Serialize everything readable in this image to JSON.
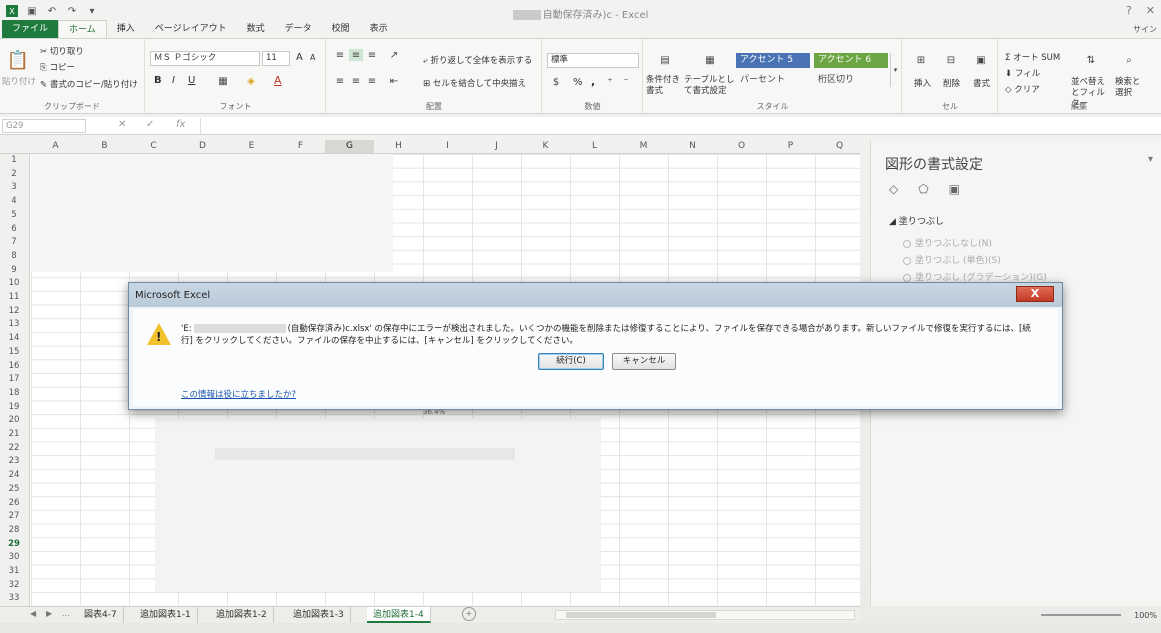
{
  "titlebar": {
    "title": "自動保存済み)c - Excel",
    "quick_access": [
      "excel-logo",
      "save",
      "undo",
      "redo"
    ]
  },
  "tabs": {
    "file": "ファイル",
    "items": [
      "ホーム",
      "挿入",
      "ページレイアウト",
      "数式",
      "データ",
      "校閲",
      "表示"
    ],
    "signin": "サイン"
  },
  "ribbon": {
    "clipboard": {
      "paste": "貼り付け",
      "cut": "切り取り",
      "copy": "コピー",
      "format_painter": "書式のコピー/貼り付け",
      "label": "クリップボード"
    },
    "font": {
      "font_name": "ＭＳ Ｐゴシック",
      "font_size": "11",
      "grow": "A",
      "shrink": "A",
      "bold": "B",
      "italic": "I",
      "underline": "U",
      "font_color": "A",
      "label": "フォント"
    },
    "alignment": {
      "wrap_text": "折り返して全体を表示する",
      "merge_center": "セルを結合して中央揃え",
      "label": "配置"
    },
    "number": {
      "format": "標準",
      "percent": "%",
      "comma": ",",
      "label": "数値"
    },
    "styles": {
      "conditional": "条件付き書式",
      "table": "テーブルとして書式設定",
      "accent5": "アクセント 5",
      "accent6": "アクセント 6",
      "percent": "パーセント",
      "comma": "桁区切り",
      "label": "スタイル"
    },
    "cells": {
      "insert": "挿入",
      "delete": "削除",
      "format": "書式",
      "label": "セル"
    },
    "editing": {
      "autosum": "オート SUM",
      "fill": "フィル",
      "clear": "クリア",
      "sort_filter": "並べ替えとフィルター",
      "find_select": "検索と選択",
      "label": "編集"
    }
  },
  "formula_bar": {
    "name_box": "G29",
    "fx": "fx"
  },
  "grid": {
    "columns": [
      "A",
      "B",
      "C",
      "D",
      "E",
      "F",
      "G",
      "H",
      "I",
      "J",
      "K",
      "L",
      "M",
      "N",
      "O",
      "P",
      "Q"
    ],
    "selected_column": "G",
    "rows": [
      "1",
      "2",
      "3",
      "4",
      "5",
      "6",
      "7",
      "8",
      "9",
      "10",
      "11",
      "12",
      "13",
      "14",
      "15",
      "16",
      "17",
      "18",
      "19",
      "20",
      "21",
      "22",
      "23",
      "24",
      "25",
      "26",
      "27",
      "28",
      "29",
      "30",
      "31",
      "32",
      "33"
    ],
    "selected_row": "29",
    "percent_label": "36.4%"
  },
  "sheet_tabs": {
    "nav": [
      "◀",
      "▶",
      "..."
    ],
    "tabs": [
      "図表4-7",
      "追加図表1-1",
      "追加図表1-2",
      "追加図表1-3",
      "追加図表1-4"
    ],
    "active": "追加図表1-4",
    "add": "+"
  },
  "status": {
    "zoom": "100%"
  },
  "pane": {
    "title": "図形の書式設定",
    "section": "塗りつぶし",
    "options": [
      "塗りつぶしなし(N)",
      "塗りつぶし (単色)(S)",
      "塗りつぶし (グラデーション)(G)"
    ]
  },
  "dialog": {
    "title": "Microsoft Excel",
    "close": "X",
    "message_prefix": "'E:",
    "message_rest": "(自動保存済み)c.xlsx' の保存中にエラーが検出されました。いくつかの機能を削除または修復することにより、ファイルを保存できる場合があります。新しいファイルで修復を実行するには、[続行] をクリックしてください。ファイルの保存を中止するには、[キャンセル] をクリックしてください。",
    "continue": "続行(C)",
    "cancel": "キャンセル",
    "help_link": "この情報は役に立ちましたか?"
  }
}
